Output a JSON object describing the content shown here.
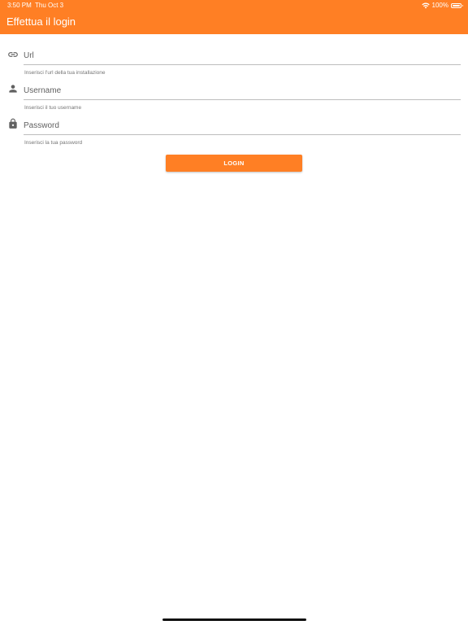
{
  "status_bar": {
    "time": "3:50 PM",
    "date": "Thu Oct 3",
    "battery": "100%",
    "icons": [
      "wifi-icon",
      "battery-icon"
    ]
  },
  "appbar": {
    "title": "Effettua il login",
    "color": "#FF7F24"
  },
  "form": {
    "url": {
      "icon": "link-icon",
      "placeholder": "Url",
      "value": "",
      "helper": "Inserisci l'url della tua installazione"
    },
    "username": {
      "icon": "person-icon",
      "placeholder": "Username",
      "value": "",
      "helper": "Inserisci il tuo username"
    },
    "password": {
      "icon": "lock-icon",
      "placeholder": "Password",
      "value": "",
      "helper": "Inserisci la tua password"
    },
    "login_label": "LOGIN"
  }
}
